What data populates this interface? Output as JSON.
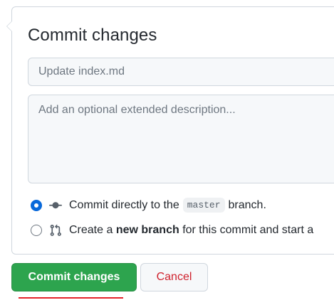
{
  "panel": {
    "title": "Commit changes",
    "summary_placeholder": "Update index.md",
    "description_placeholder": "Add an optional extended description..."
  },
  "options": {
    "direct": {
      "selected": true,
      "icon": "git-commit-icon",
      "prefix": "Commit directly to the",
      "branch": "master",
      "suffix": "branch."
    },
    "new_branch": {
      "selected": false,
      "icon": "git-pull-request-icon",
      "prefix": "Create a",
      "bold": "new branch",
      "suffix": "for this commit and start a"
    }
  },
  "buttons": {
    "commit_label": "Commit changes",
    "cancel_label": "Cancel"
  },
  "colors": {
    "primary_green": "#2da44e",
    "danger_red": "#cf222e",
    "radio_blue": "#0969da",
    "annotation_red": "#e5222a"
  }
}
